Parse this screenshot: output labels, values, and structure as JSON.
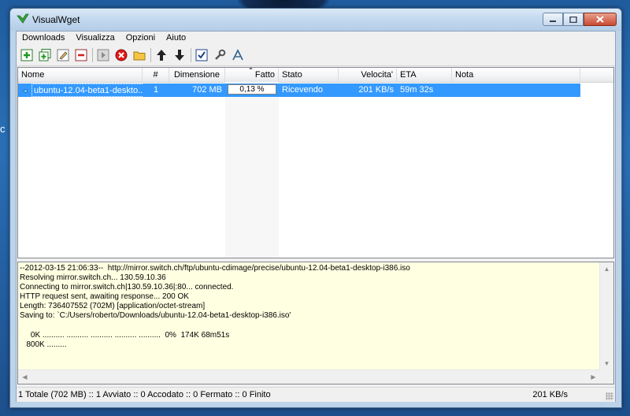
{
  "window": {
    "title": "VisualWget"
  },
  "menu": [
    "Downloads",
    "Visualizza",
    "Opzioni",
    "Aiuto"
  ],
  "toolbar": [
    {
      "name": "add-download-icon"
    },
    {
      "name": "add-batch-icon"
    },
    {
      "name": "edit-download-icon"
    },
    {
      "name": "remove-download-icon"
    },
    {
      "sep": true
    },
    {
      "name": "start-icon"
    },
    {
      "name": "stop-icon"
    },
    {
      "name": "open-folder-icon"
    },
    {
      "sep": true
    },
    {
      "name": "move-up-icon"
    },
    {
      "name": "move-down-icon"
    },
    {
      "sep": true
    },
    {
      "name": "select-all-icon"
    },
    {
      "name": "options-icon"
    },
    {
      "name": "scheduler-icon"
    }
  ],
  "table": {
    "columns": [
      "Nome",
      "#",
      "Dimensione",
      "Fatto",
      "Stato",
      "Velocita'",
      "ETA",
      "Nota"
    ],
    "rows": [
      {
        "name": "ubuntu-12.04-beta1-deskto...",
        "num": "1",
        "size": "702 MB",
        "progress_text": "0,13 %",
        "progress_fraction": 0.0013,
        "status": "Ricevendo",
        "speed": "201 KB/s",
        "eta": "59m 32s",
        "note": ""
      }
    ]
  },
  "log": {
    "lines": [
      "--2012-03-15 21:06:33--  http://mirror.switch.ch/ftp/ubuntu-cdimage/precise/ubuntu-12.04-beta1-desktop-i386.iso",
      "Resolving mirror.switch.ch... 130.59.10.36",
      "Connecting to mirror.switch.ch|130.59.10.36|:80... connected.",
      "HTTP request sent, awaiting response... 200 OK",
      "Length: 736407552 (702M) [application/octet-stream]",
      "Saving to: `C:/Users/roberto/Downloads/ubuntu-12.04-beta1-desktop-i386.iso'",
      "",
      "     0K .......... .......... .......... .......... ..........  0%  174K 68m51s",
      "   800K ........."
    ]
  },
  "status": {
    "summary": "1 Totale (702 MB) :: 1 Avviato :: 0 Accodato :: 0 Fermato :: 0 Finito",
    "speed": "201 KB/s"
  }
}
